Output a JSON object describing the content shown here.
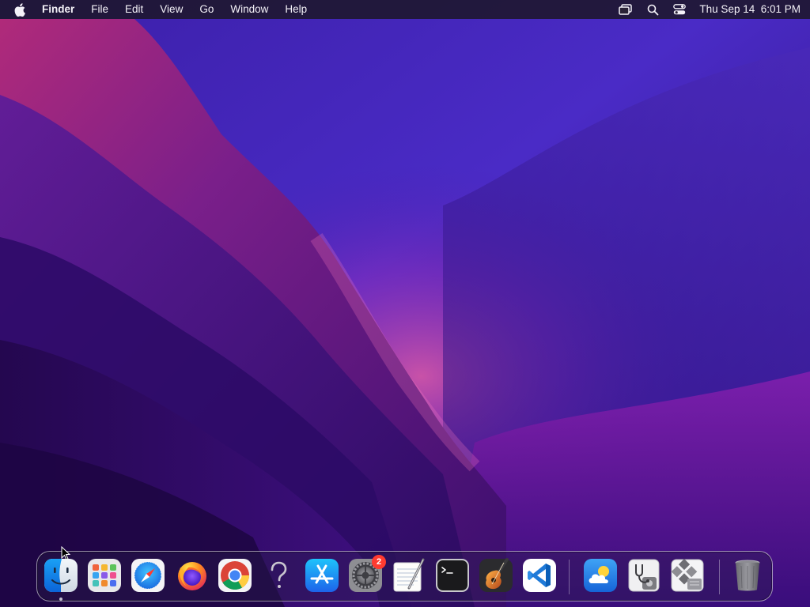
{
  "menubar": {
    "app_name": "Finder",
    "menus": [
      "File",
      "Edit",
      "View",
      "Go",
      "Window",
      "Help"
    ],
    "status_icons": [
      "screen-mirroring-icon",
      "spotlight-search-icon",
      "control-center-icon"
    ],
    "clock": "Thu Sep 14  6:01 PM"
  },
  "dock": {
    "apps": [
      {
        "name": "Finder",
        "icon": "finder-icon",
        "running": true
      },
      {
        "name": "Launchpad",
        "icon": "launchpad-icon"
      },
      {
        "name": "Safari",
        "icon": "safari-icon"
      },
      {
        "name": "Firefox",
        "icon": "firefox-icon"
      },
      {
        "name": "Google Chrome",
        "icon": "chrome-icon"
      },
      {
        "name": "Help",
        "icon": "question-mark-icon"
      },
      {
        "name": "App Store",
        "icon": "app-store-icon"
      },
      {
        "name": "System Preferences",
        "icon": "system-preferences-icon",
        "badge": "2"
      },
      {
        "name": "TextEdit",
        "icon": "textedit-icon"
      },
      {
        "name": "Terminal",
        "icon": "terminal-icon"
      },
      {
        "name": "GarageBand",
        "icon": "garageband-icon"
      },
      {
        "name": "Visual Studio Code",
        "icon": "vscode-icon"
      }
    ],
    "extras": [
      {
        "name": "Weather",
        "icon": "weather-icon"
      },
      {
        "name": "Disk Utility",
        "icon": "disk-utility-icon"
      },
      {
        "name": "Boot Camp Assistant",
        "icon": "bootcamp-icon"
      }
    ],
    "trash": {
      "name": "Trash",
      "icon": "trash-icon"
    }
  },
  "colors": {
    "menubar_bg": "#1c1628",
    "badge": "#ff3b30",
    "wallpaper_dark": "#230a5c",
    "wallpaper_accent": "#c23a8a"
  }
}
